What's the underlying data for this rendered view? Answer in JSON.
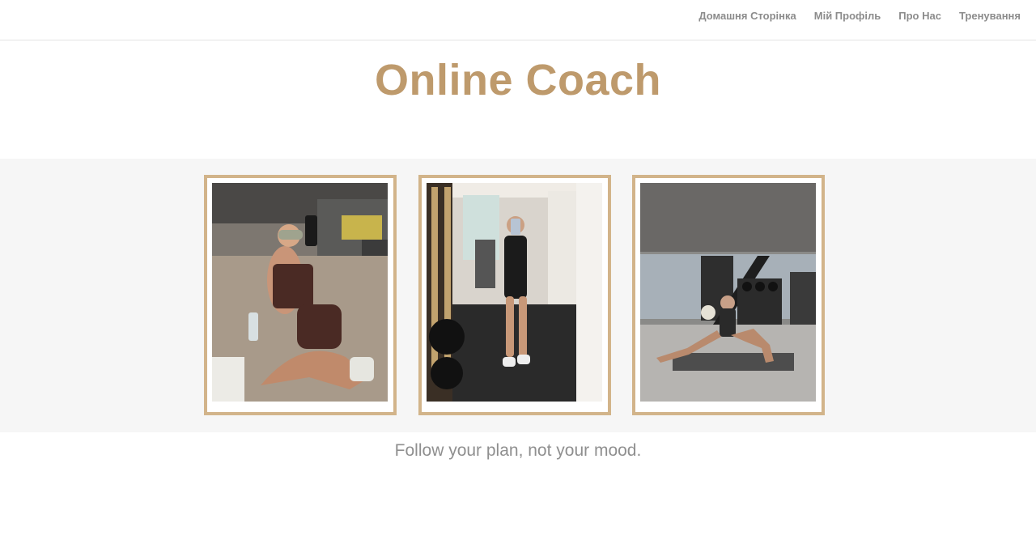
{
  "nav": {
    "items": [
      {
        "label": "Домашня Сторінка"
      },
      {
        "label": "Мій Профіль"
      },
      {
        "label": "Про Нас"
      },
      {
        "label": "Тренування"
      }
    ]
  },
  "hero": {
    "title": "Online Coach"
  },
  "gallery": {
    "photos": [
      {
        "subject": "gym-mirror-selfie-sitting"
      },
      {
        "subject": "gym-mirror-selfie-standing"
      },
      {
        "subject": "gym-lunge-stretch"
      }
    ]
  },
  "quote": {
    "text": "Follow your plan, not your mood."
  },
  "colors": {
    "accent": "#be9a6c",
    "frame": "#d2b48a",
    "nav_text": "#8c8c8c",
    "gallery_bg": "#f6f6f6",
    "quote_text": "#8f8f8f"
  }
}
